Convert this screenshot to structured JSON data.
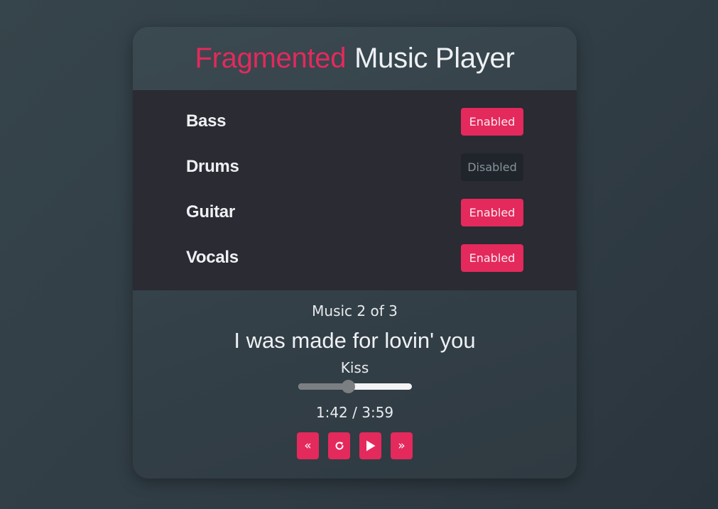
{
  "header": {
    "title_accent": "Fragmented",
    "title_rest": "Music Player"
  },
  "tracks": [
    {
      "name": "Bass",
      "status": "Enabled",
      "enabled": true
    },
    {
      "name": "Drums",
      "status": "Disabled",
      "enabled": false
    },
    {
      "name": "Guitar",
      "status": "Enabled",
      "enabled": true
    },
    {
      "name": "Vocals",
      "status": "Enabled",
      "enabled": true
    }
  ],
  "player": {
    "counter": "Music 2 of 3",
    "song_title": "I was made for lovin' you",
    "artist": "Kiss",
    "progress_fraction": 0.439,
    "time": "1:42 / 3:59",
    "controls": {
      "prev": "«",
      "replay_icon": "replay-icon",
      "play_icon": "play-icon",
      "next": "»"
    }
  },
  "colors": {
    "accent": "#e4295c",
    "panel": "#2a2b33",
    "disabled_bg": "#1f252b"
  }
}
